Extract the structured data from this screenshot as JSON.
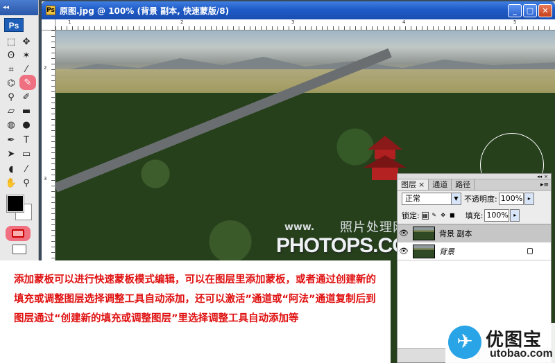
{
  "toolbox": {
    "app_logo": "Ps"
  },
  "document": {
    "title": "原图.jpg @ 100% (背景 副本, 快速蒙版/8)",
    "ruler_numbers": [
      "1",
      "2",
      "3",
      "4",
      "5"
    ]
  },
  "watermark": {
    "cn": "照片处理网",
    "www": "www.",
    "en": "PHOTOPS.COM"
  },
  "annotation": {
    "text": "添加蒙板可以进行快速蒙板模式编辑，可以在图层里添加蒙板，或者通过创建新的填充或调整图层选择调整工具自动添加，还可以激活”通道或“阿法”通道复制后到图层通过“创建新的填充或调整图层”里选择调整工具自动添加等"
  },
  "layers_panel": {
    "tabs": [
      {
        "label": "图层",
        "close": "×"
      },
      {
        "label": "通道"
      },
      {
        "label": "路径"
      }
    ],
    "blend_mode": "正常",
    "opacity_label": "不透明度:",
    "opacity_value": "100%",
    "lock_label": "锁定:",
    "fill_label": "填充:",
    "fill_value": "100%",
    "layers": [
      {
        "name": "背景 副本"
      },
      {
        "name": "背景"
      }
    ]
  },
  "site_logo": {
    "name": "优图宝",
    "url": "utobao.com"
  },
  "colors": {
    "highlight": "#f05a6e",
    "annotation_text": "#e01010",
    "titlebar": "#1f5bc8"
  }
}
